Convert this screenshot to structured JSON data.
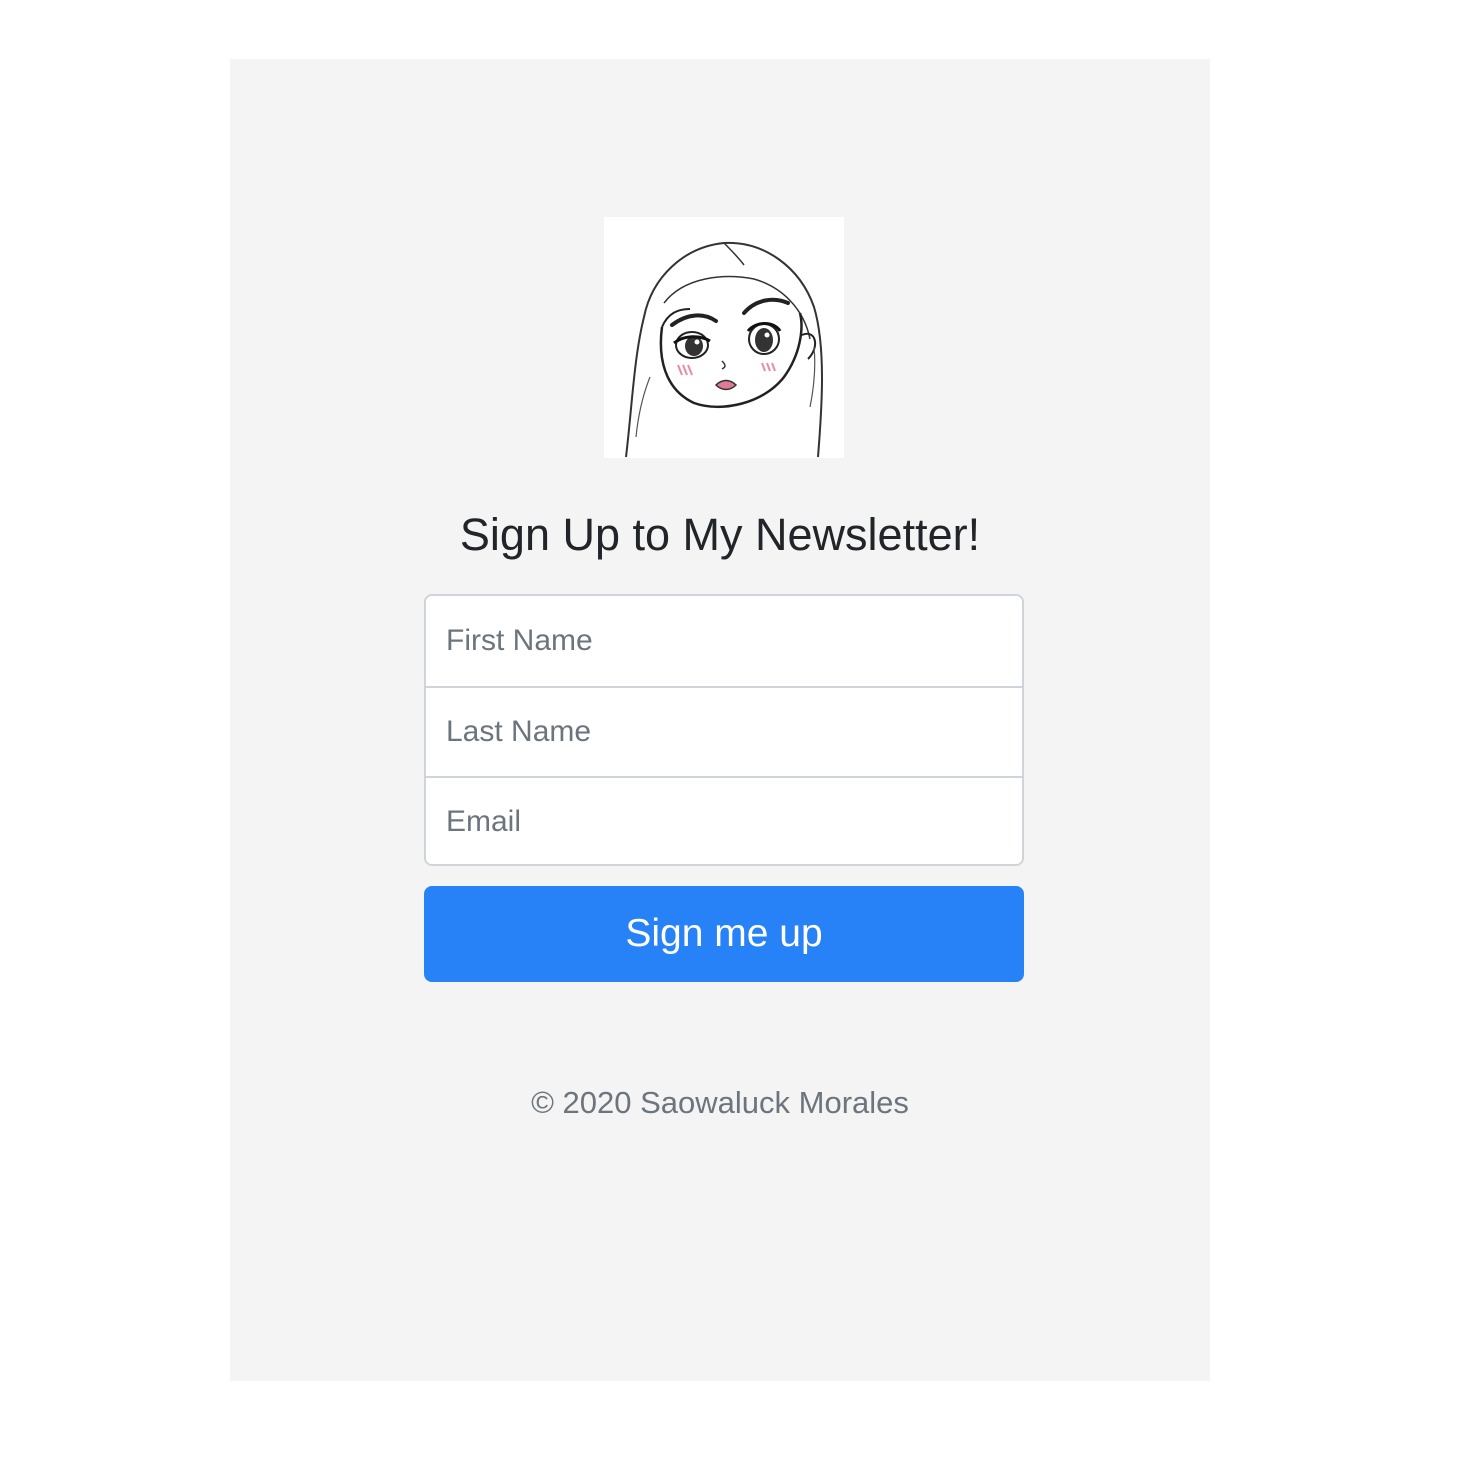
{
  "form": {
    "heading": "Sign Up to My Newsletter!",
    "first_name_placeholder": "First Name",
    "last_name_placeholder": "Last Name",
    "email_placeholder": "Email",
    "submit_label": "Sign me up"
  },
  "footer": {
    "copyright": "© 2020 Saowaluck Morales"
  },
  "colors": {
    "panel_background": "#f4f4f4",
    "button": "#2781f7",
    "heading_text": "#212529",
    "muted_text": "#6c757d"
  },
  "logo": {
    "icon": "avatar-illustration"
  }
}
